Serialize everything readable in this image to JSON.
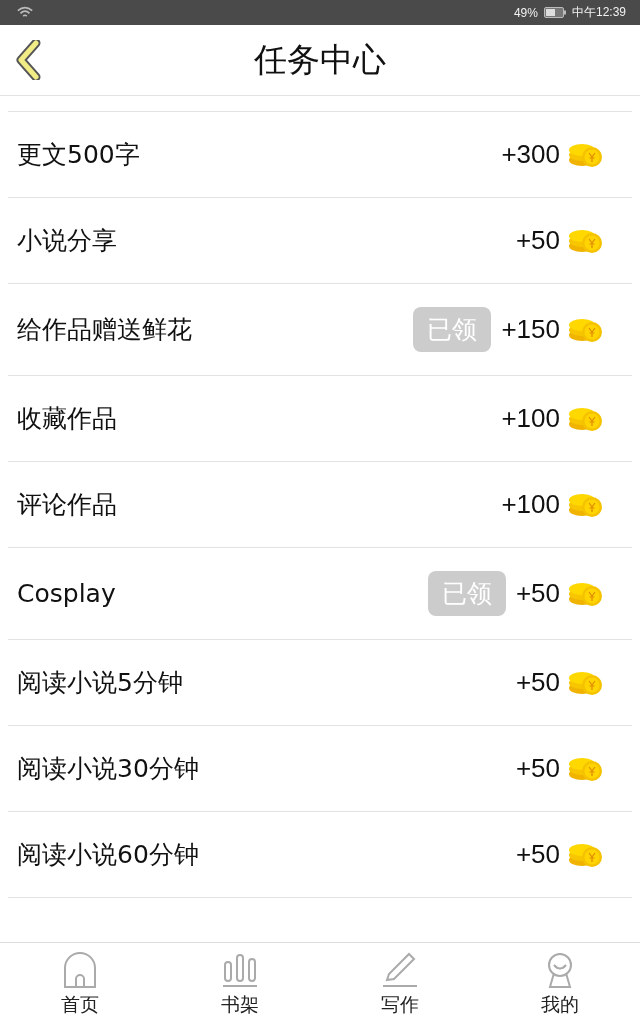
{
  "status_bar": {
    "battery": "49%",
    "time": "中午12:39"
  },
  "header": {
    "title": "任务中心"
  },
  "tasks": [
    {
      "name": "更文500字",
      "reward": "+300"
    },
    {
      "name": "小说分享",
      "reward": "+50"
    },
    {
      "name": "给作品赠送鲜花",
      "badge": "已领",
      "reward": "+150"
    },
    {
      "name": "收藏作品",
      "reward": "+100"
    },
    {
      "name": "评论作品",
      "reward": "+100"
    },
    {
      "name": "Cosplay",
      "badge": "已领",
      "reward": "+50"
    },
    {
      "name": "阅读小说5分钟",
      "reward": "+50"
    },
    {
      "name": "阅读小说30分钟",
      "reward": "+50"
    },
    {
      "name": "阅读小说60分钟",
      "reward": "+50"
    }
  ],
  "tab_bar": [
    {
      "kind": "home",
      "label": "首页"
    },
    {
      "kind": "shelf",
      "label": "书架"
    },
    {
      "kind": "write",
      "label": "写作"
    },
    {
      "kind": "me",
      "label": "我的"
    }
  ]
}
